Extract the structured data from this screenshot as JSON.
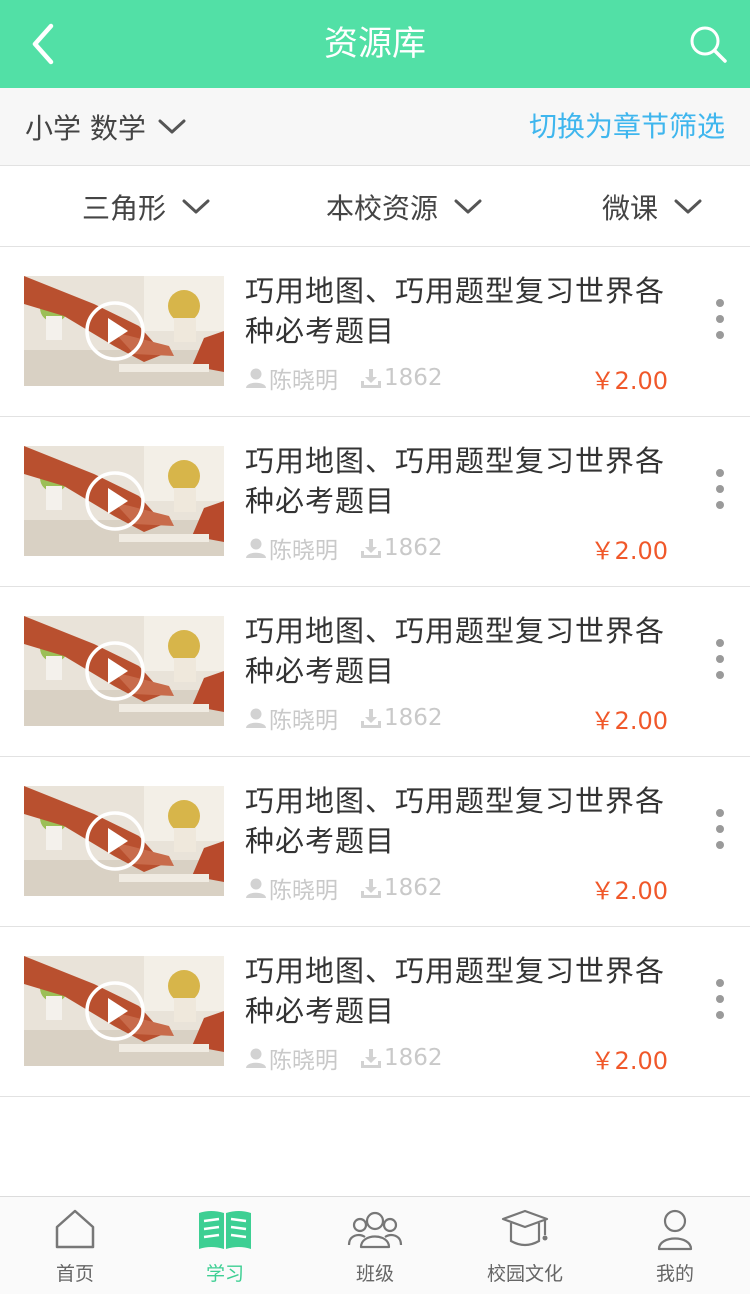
{
  "header": {
    "title": "资源库",
    "back_icon": "chevron-left-icon",
    "search_icon": "search-icon"
  },
  "subject_bar": {
    "subject": "小学 数学",
    "switch_label": "切换为章节筛选"
  },
  "filters": [
    {
      "label": "三角形"
    },
    {
      "label": "本校资源"
    },
    {
      "label": "微课"
    }
  ],
  "resources": [
    {
      "title": "巧用地图、巧用题型复习世界各种必考题目",
      "author": "陈晓明",
      "downloads": "1862",
      "price": "￥2.00"
    },
    {
      "title": "巧用地图、巧用题型复习世界各种必考题目",
      "author": "陈晓明",
      "downloads": "1862",
      "price": "￥2.00"
    },
    {
      "title": "巧用地图、巧用题型复习世界各种必考题目",
      "author": "陈晓明",
      "downloads": "1862",
      "price": "￥2.00"
    },
    {
      "title": "巧用地图、巧用题型复习世界各种必考题目",
      "author": "陈晓明",
      "downloads": "1862",
      "price": "￥2.00"
    },
    {
      "title": "巧用地图、巧用题型复习世界各种必考题目",
      "author": "陈晓明",
      "downloads": "1862",
      "price": "￥2.00"
    }
  ],
  "tabbar": [
    {
      "label": "首页",
      "icon": "home-icon"
    },
    {
      "label": "学习",
      "icon": "book-icon",
      "active": true
    },
    {
      "label": "班级",
      "icon": "group-icon"
    },
    {
      "label": "校园文化",
      "icon": "graduation-cap-icon"
    },
    {
      "label": "我的",
      "icon": "user-icon"
    }
  ],
  "colors": {
    "primary": "#52e0a6",
    "link": "#3fb6ee",
    "price": "#f0582a",
    "tab_active": "#3dcf93"
  }
}
